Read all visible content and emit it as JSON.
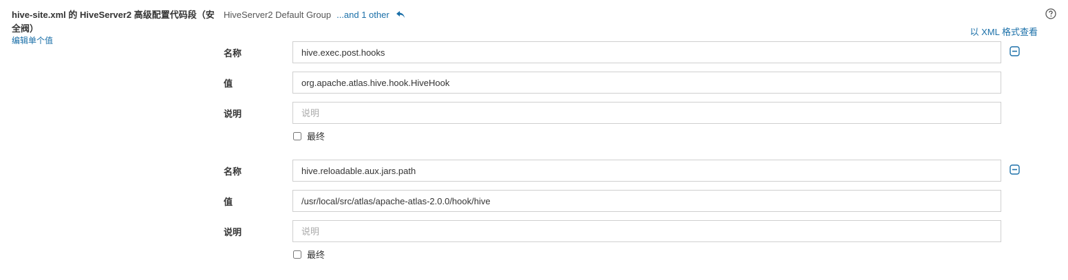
{
  "section": {
    "title": "hive-site.xml 的 HiveServer2 高级配置代码段（安全阀）",
    "edit_link": "编辑单个值"
  },
  "group": {
    "name": "HiveServer2 Default Group",
    "others_link": "...and 1 other"
  },
  "view_as_xml": "以 XML 格式查看",
  "labels": {
    "name": "名称",
    "value": "值",
    "description": "说明",
    "final": "最终"
  },
  "entries": [
    {
      "name": "hive.exec.post.hooks",
      "value": "org.apache.atlas.hive.hook.HiveHook",
      "description": "",
      "description_placeholder": "说明",
      "final": false
    },
    {
      "name": "hive.reloadable.aux.jars.path",
      "value": "/usr/local/src/atlas/apache-atlas-2.0.0/hook/hive",
      "description": "",
      "description_placeholder": "说明",
      "final": false
    }
  ],
  "colors": {
    "link": "#1a6fa8",
    "border": "#cfcfcf"
  },
  "icons": {
    "undo": "undo-arrow-icon",
    "help": "help-circle-icon",
    "remove": "minus-square-icon"
  }
}
